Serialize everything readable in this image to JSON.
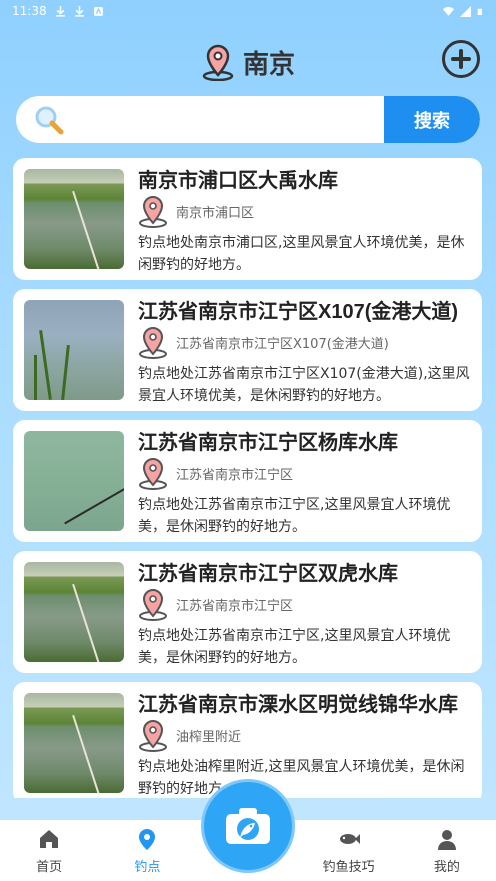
{
  "status_bar": {
    "time": "11:38"
  },
  "header": {
    "city": "南京",
    "pin_icon": "location-pin-icon",
    "add_icon": "plus-circle-icon"
  },
  "search": {
    "placeholder": "",
    "value": "",
    "button_label": "搜索",
    "icon": "magnifier-icon"
  },
  "spots": [
    {
      "title": "南京市浦口区大禹水库",
      "location": "南京市浦口区",
      "description": "钓点地处南京市浦口区,这里风景宜人环境优美，是休闲野钓的好地方。"
    },
    {
      "title": "江苏省南京市江宁区X107(金港大道)",
      "location": "江苏省南京市江宁区X107(金港大道)",
      "description": "钓点地处江苏省南京市江宁区X107(金港大道),这里风景宜人环境优美，是休闲野钓的好地方。"
    },
    {
      "title": "江苏省南京市江宁区杨库水库",
      "location": "江苏省南京市江宁区",
      "description": "钓点地处江苏省南京市江宁区,这里风景宜人环境优美，是休闲野钓的好地方。"
    },
    {
      "title": "江苏省南京市江宁区双虎水库",
      "location": "江苏省南京市江宁区",
      "description": "钓点地处江苏省南京市江宁区,这里风景宜人环境优美，是休闲野钓的好地方。"
    },
    {
      "title": "江苏省南京市溧水区明觉线锦华水库",
      "location": "油榨里附近",
      "description": "钓点地处油榨里附近,这里风景宜人环境优美，是休闲野钓的好地方。"
    }
  ],
  "bottom_nav": {
    "items": [
      {
        "label": "首页",
        "icon": "home-icon"
      },
      {
        "label": "钓点",
        "icon": "location-dot-icon",
        "active": true
      },
      {
        "label": "钓鱼技巧",
        "icon": "fish-icon"
      },
      {
        "label": "我的",
        "icon": "user-icon"
      }
    ],
    "center_button_icon": "camera-fish-icon"
  },
  "colors": {
    "accent": "#2196f3",
    "search_button": "#1e8ff0",
    "background_top": "#8fd0ff"
  }
}
